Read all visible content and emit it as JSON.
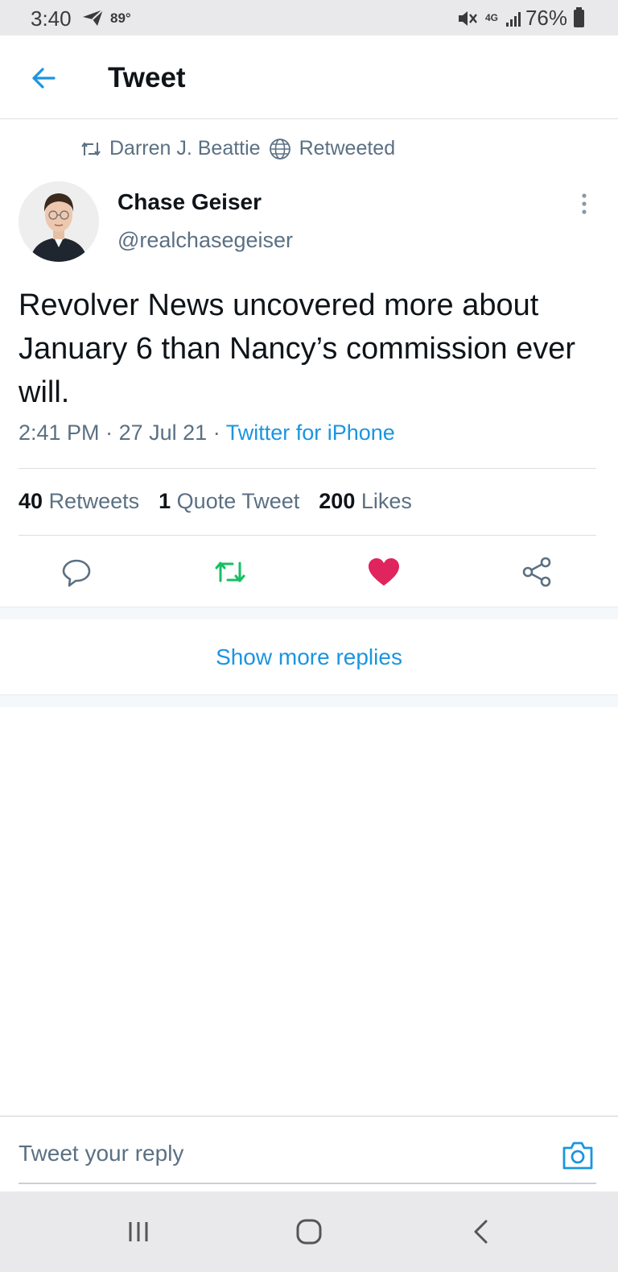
{
  "status_bar": {
    "time": "3:40",
    "temperature": "89°",
    "network": "4G",
    "battery": "76%"
  },
  "header": {
    "title": "Tweet"
  },
  "retweet_context": {
    "user": "Darren J. Beattie",
    "label": "Retweeted"
  },
  "tweet": {
    "author_name": "Chase Geiser",
    "author_handle": "@realchasegeiser",
    "text": "Revolver News uncovered more about January 6 than Nancy’s commission ever will.",
    "time": "2:41 PM",
    "date": "27 Jul 21",
    "source": "Twitter for iPhone",
    "separator": "·"
  },
  "stats": {
    "retweets_count": "40",
    "retweets_label": "Retweets",
    "quotes_count": "1",
    "quotes_label": "Quote Tweet",
    "likes_count": "200",
    "likes_label": "Likes"
  },
  "actions": {
    "reply_icon": "reply-icon",
    "retweet_icon": "retweet-icon",
    "like_icon": "heart-icon",
    "share_icon": "share-icon"
  },
  "replies": {
    "show_more": "Show more replies"
  },
  "reply_box": {
    "placeholder": "Tweet your reply"
  },
  "colors": {
    "accent": "#1b95e0",
    "retweet_active": "#17bf63",
    "like_active": "#e0245e",
    "secondary_text": "#5b7083"
  }
}
